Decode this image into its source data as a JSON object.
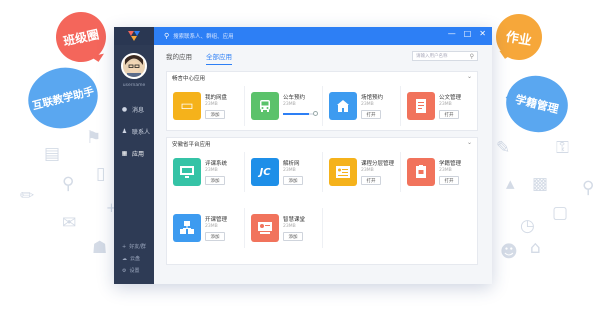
{
  "colors": {
    "accent": "#2d7ff5",
    "sidebar": "#2e3b55",
    "bubble_red": "#f4665b",
    "bubble_orange": "#f6a73a",
    "bubble_blue": "#5aa7f0"
  },
  "bubbles": {
    "class": "班级圈",
    "assistant": "互联教学助手",
    "homework": "作业",
    "student": "学籍管理"
  },
  "window": {
    "search_placeholder": "搜索联系人、群组、应用",
    "controls": [
      "—",
      "□",
      "✕"
    ]
  },
  "sidebar": {
    "username": "username",
    "items": [
      {
        "label": "消息",
        "icon": "message-icon"
      },
      {
        "label": "联系人",
        "icon": "contacts-icon"
      },
      {
        "label": "应用",
        "icon": "apps-icon"
      }
    ],
    "footer": [
      {
        "label": "好友/群",
        "icon": "add-icon"
      },
      {
        "label": "云盘",
        "icon": "cloud-icon"
      },
      {
        "label": "设置",
        "icon": "settings-icon"
      }
    ]
  },
  "tabs": [
    "我的应用",
    "全部应用"
  ],
  "active_tab": "全部应用",
  "find_placeholder": "请输入用户名称",
  "sections": [
    {
      "title": "畅言中心应用",
      "apps": [
        {
          "name": "我的网盘",
          "size": "23MB",
          "button": "添加",
          "color": "#f5b21b",
          "icon": "disk-icon"
        },
        {
          "name": "公车预约",
          "size": "23MB",
          "progress": 0.82,
          "color": "#5bc26b",
          "icon": "bus-icon"
        },
        {
          "name": "场馆预约",
          "size": "23MB",
          "button": "打开",
          "color": "#3d9bf0",
          "icon": "building-icon"
        },
        {
          "name": "公文管理",
          "size": "23MB",
          "button": "打开",
          "color": "#f1735c",
          "icon": "document-icon"
        }
      ]
    },
    {
      "title": "安徽省平台应用",
      "apps": [
        {
          "name": "评课系统",
          "size": "23MB",
          "button": "添加",
          "color": "#35c3a6",
          "icon": "monitor-icon"
        },
        {
          "name": "解析网",
          "size": "23MB",
          "button": "添加",
          "color": "#1e8fe8",
          "icon": "jc-logo-icon"
        },
        {
          "name": "课程分层管理",
          "size": "23MB",
          "button": "打开",
          "color": "#f5b21b",
          "icon": "list-icon"
        },
        {
          "name": "学籍管理",
          "size": "23MB",
          "button": "打开",
          "color": "#f1735c",
          "icon": "student-card-icon"
        },
        {
          "name": "开课管理",
          "size": "23MB",
          "button": "添加",
          "color": "#3d9bf0",
          "icon": "blocks-icon"
        },
        {
          "name": "智慧课堂",
          "size": "23MB",
          "button": "添加",
          "color": "#f1735c",
          "icon": "classroom-icon"
        }
      ]
    }
  ]
}
